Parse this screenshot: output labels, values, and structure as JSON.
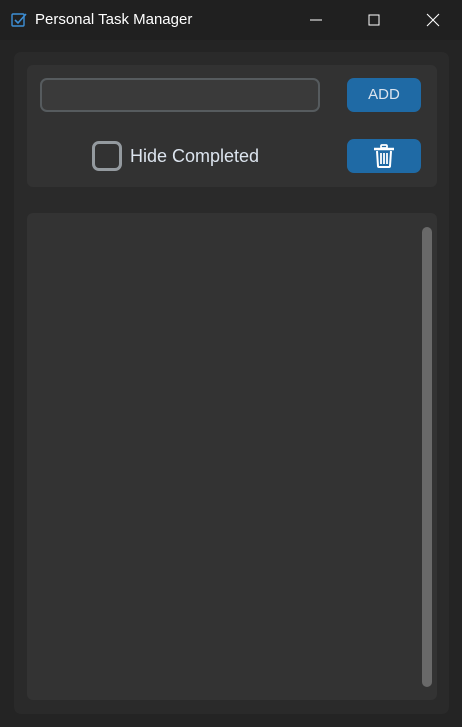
{
  "window": {
    "title": "Personal Task Manager",
    "app_icon": "checkbox-icon",
    "controls": [
      "minimize-icon",
      "maximize-icon",
      "close-icon"
    ]
  },
  "controls": {
    "task_input_value": "",
    "task_input_placeholder": "",
    "add_label": "ADD",
    "hide_completed_label": "Hide Completed",
    "hide_completed_checked": false,
    "delete_icon": "trash-icon"
  },
  "task_list": {
    "items": []
  },
  "colors": {
    "accent": "#1f6aa5",
    "background": "#242424",
    "panel": "#323232",
    "text": "#dce4ee"
  }
}
